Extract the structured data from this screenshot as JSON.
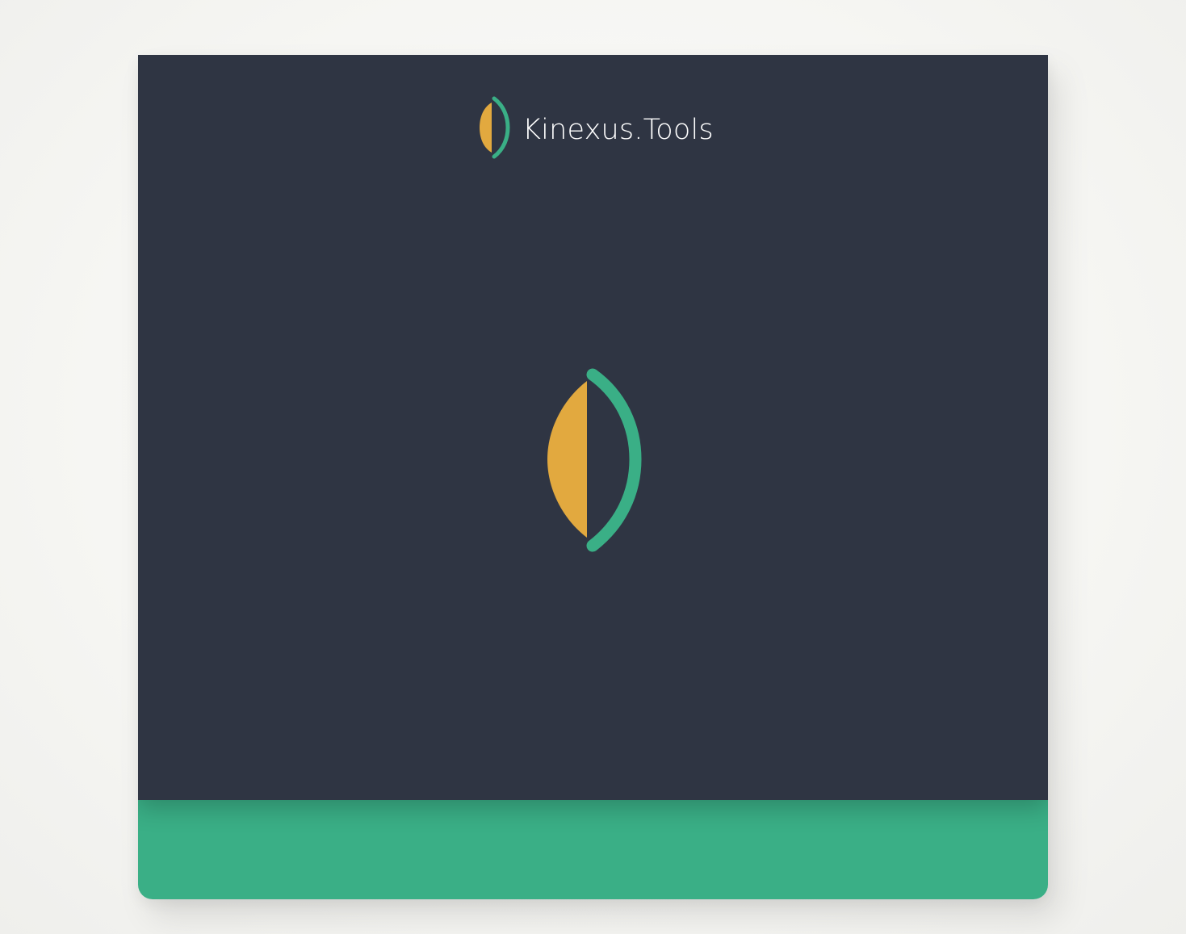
{
  "brand": {
    "name": "Kinexus.Tools",
    "logo_icon": "leaf-mark-icon"
  },
  "hero": {
    "icon": "leaf-mark-icon"
  },
  "colors": {
    "background": "#f6f6f3",
    "panel": "#2f3543",
    "accent_green": "#3aaf86",
    "accent_orange": "#e2a93f",
    "text": "#ffffff"
  }
}
